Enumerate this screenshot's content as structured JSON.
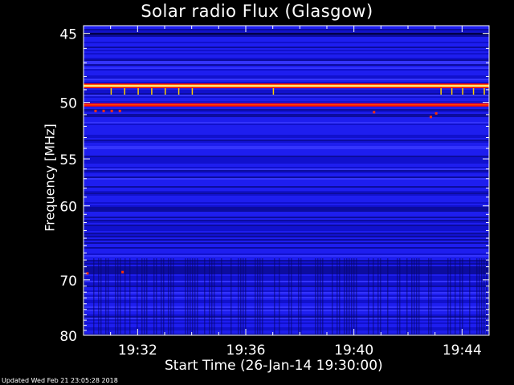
{
  "chart_data": {
    "type": "heatmap",
    "title": "Solar radio Flux (Glasgow)",
    "xlabel": "Start Time (26-Jan-14 19:30:00)",
    "ylabel": "Frequency [MHz]",
    "x_ticks": [
      "19:32",
      "19:36",
      "19:40",
      "19:44"
    ],
    "x_tick_minutes": [
      2,
      6,
      10,
      14
    ],
    "x_range_minutes": [
      0,
      15
    ],
    "y_ticks": [
      45,
      50,
      55,
      60,
      70,
      80
    ],
    "y_range_mhz": [
      44.5,
      80
    ],
    "y_scale": "reciprocal",
    "colormap": [
      "#000060",
      "#1818ff",
      "#ff0000",
      "#ffd000",
      "#ffffff"
    ],
    "bright_bands_mhz": [
      48.7,
      50.2
    ]
  },
  "footer": "Updated Wed Feb 21 23:05:28 2018"
}
